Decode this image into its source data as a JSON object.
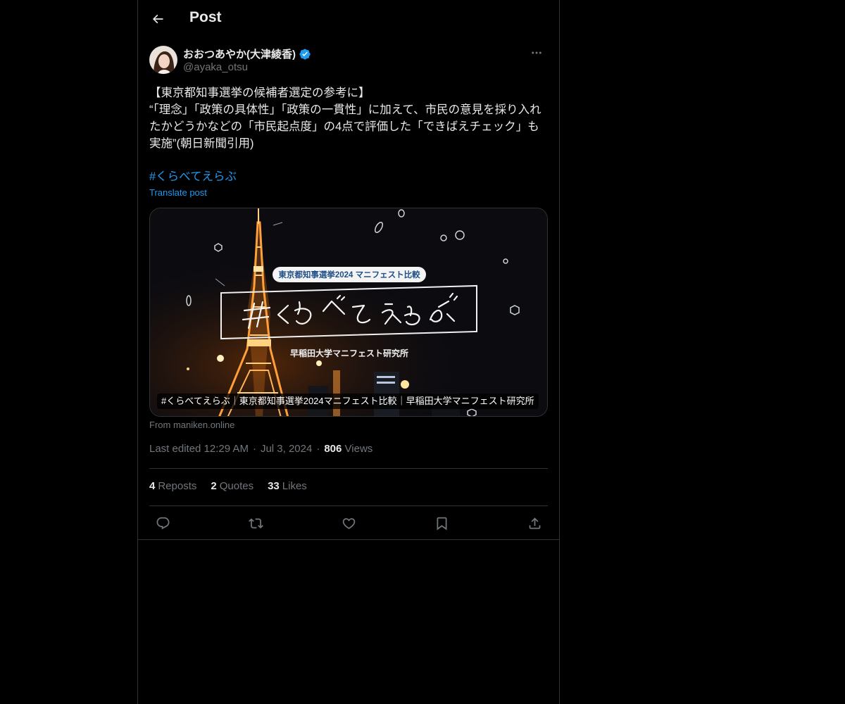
{
  "header": {
    "title": "Post"
  },
  "author": {
    "display_name": "おおつあやか(大津綾香)",
    "handle": "@ayaka_otsu"
  },
  "post": {
    "text": "【東京都知事選挙の候補者選定の参考に】\n“「理念」「政策の具体性」「政策の一貫性」に加えて、市民の意見を採り入れたかどうかなどの「市民起点度」の4点で評価した「できばえチェック」も実施”(朝日新聞引用)",
    "hashtag": "#くらべてえらぶ",
    "translate_label": "Translate post"
  },
  "card": {
    "badge": "東京都知事選挙2024 マニフェスト比較",
    "handwritten_title": "#くらべて えらぶ",
    "subtitle": "早稲田大学マニフェスト研究所",
    "caption": "#くらべてえらぶ｜東京都知事選挙2024マニフェスト比較｜早稲田大学マニフェスト研究所",
    "source": "From maniken.online"
  },
  "meta": {
    "edited": "Last edited 12:29 AM",
    "separator": "·",
    "date": "Jul 3, 2024",
    "views_count": "806",
    "views_label": "Views"
  },
  "stats": {
    "reposts_count": "4",
    "reposts_label": "Reposts",
    "quotes_count": "2",
    "quotes_label": "Quotes",
    "likes_count": "33",
    "likes_label": "Likes"
  },
  "icons": {
    "back": "arrow-left-icon",
    "verified": "verified-badge-icon",
    "more": "more-dots-icon",
    "reply": "reply-icon",
    "repost": "repost-icon",
    "like": "heart-icon",
    "bookmark": "bookmark-icon",
    "share": "share-icon"
  },
  "colors": {
    "background": "#000000",
    "text": "#e7e9ea",
    "muted": "#71767b",
    "accent": "#1d9bf0",
    "border": "#2f3336"
  }
}
